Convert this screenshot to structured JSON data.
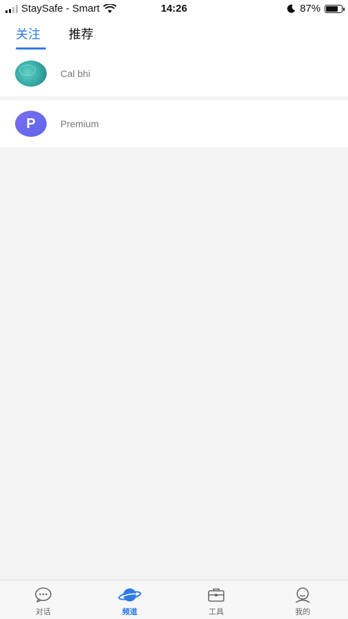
{
  "status_bar": {
    "carrier": "StaySafe - Smart",
    "time": "14:26",
    "battery_percent": "87%",
    "battery_level": 0.87,
    "icons": [
      "signal-icon",
      "wifi-icon",
      "moon-icon",
      "battery-icon"
    ]
  },
  "tabs": {
    "items": [
      {
        "label": "关注",
        "active": true
      },
      {
        "label": "推荐",
        "active": false
      }
    ]
  },
  "list": {
    "items": [
      {
        "name": "Cal bhi",
        "avatar": "photo"
      },
      {
        "name": "Premium",
        "avatar": "letter",
        "avatar_letter": "P"
      }
    ]
  },
  "bottom_nav": {
    "items": [
      {
        "label": "对话",
        "icon": "chat-bubble-icon",
        "active": false
      },
      {
        "label": "频道",
        "icon": "planet-icon",
        "active": true
      },
      {
        "label": "工具",
        "icon": "toolbox-icon",
        "active": false
      },
      {
        "label": "我的",
        "icon": "user-icon",
        "active": false
      }
    ]
  },
  "colors": {
    "accent": "#2f7ae5",
    "background": "#f4f4f4",
    "avatar_letter_bg": "#6b6aee"
  }
}
